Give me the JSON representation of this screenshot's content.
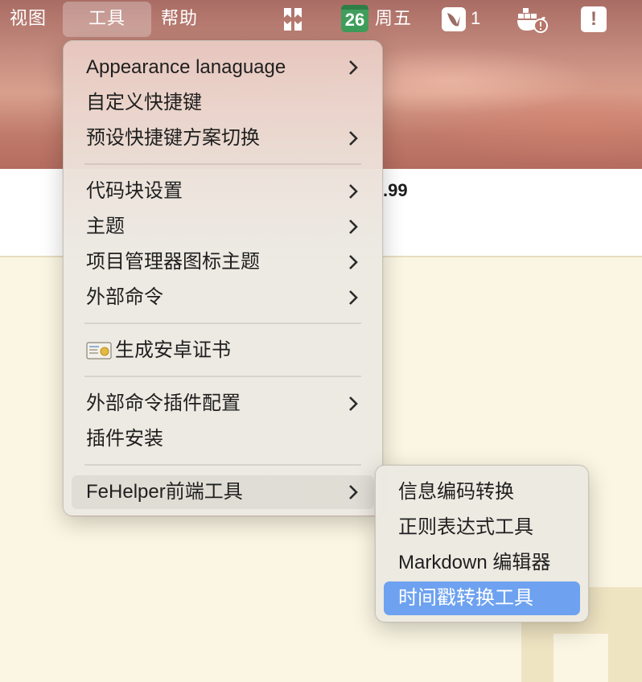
{
  "menubar": {
    "items": [
      {
        "label": "视图"
      },
      {
        "label": "工具"
      },
      {
        "label": "帮助"
      }
    ],
    "status": {
      "calendar_day": "26",
      "weekday": "周五",
      "badge_count": "1",
      "alert_mark": "!"
    }
  },
  "background": {
    "partial_text": ".99"
  },
  "tools_menu": {
    "items": [
      {
        "label": "Appearance lanaguage",
        "has_submenu": true
      },
      {
        "label": "自定义快捷键",
        "has_submenu": false
      },
      {
        "label": "预设快捷键方案切换",
        "has_submenu": true
      },
      {
        "label": "代码块设置",
        "has_submenu": true
      },
      {
        "label": "主题",
        "has_submenu": true
      },
      {
        "label": "项目管理器图标主题",
        "has_submenu": true
      },
      {
        "label": "外部命令",
        "has_submenu": true
      },
      {
        "label": "生成安卓证书",
        "has_submenu": false,
        "icon": "certificate-icon"
      },
      {
        "label": "外部命令插件配置",
        "has_submenu": true
      },
      {
        "label": "插件安装",
        "has_submenu": false
      },
      {
        "label": "FeHelper前端工具",
        "has_submenu": true,
        "highlighted": true
      }
    ]
  },
  "fehelper_submenu": {
    "items": [
      {
        "label": "信息编码转换"
      },
      {
        "label": "正则表达式工具"
      },
      {
        "label": "Markdown 编辑器"
      },
      {
        "label": "时间戳转换工具",
        "selected": true
      }
    ]
  },
  "colors": {
    "selection": "#6ea2f0",
    "calendar_green": "#3f9e5b",
    "menu_text": "#1f1f1f"
  }
}
